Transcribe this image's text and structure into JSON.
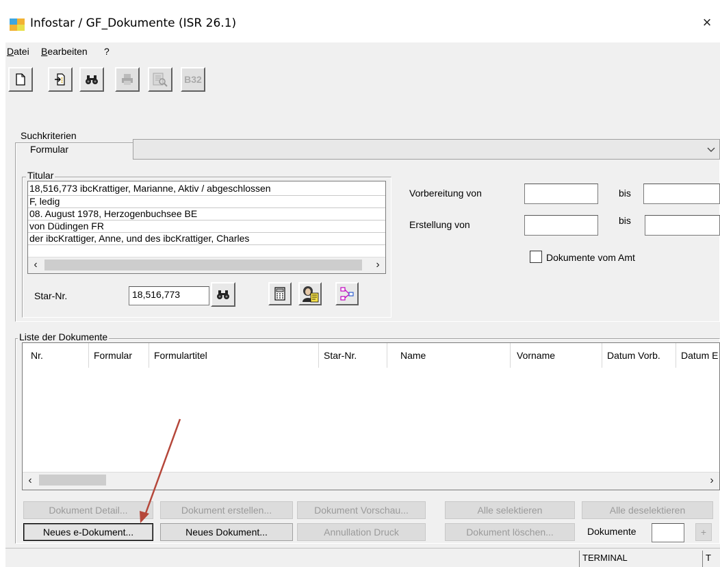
{
  "window": {
    "title": "Infostar / GF_Dokumente (ISR 26.1)",
    "close_glyph": "×"
  },
  "menu": {
    "datei_u": "D",
    "datei_rest": "atei",
    "bearbeiten_u": "B",
    "bearbeiten_rest": "earbeiten",
    "help": "?"
  },
  "toolbar": {
    "b32_label": "B32"
  },
  "search": {
    "legend": "Suchkriterien",
    "formular_label": "Formular",
    "formular_value": "",
    "titular_legend": "Titular",
    "titular_lines": [
      "18,516,773  ibcKrattiger, Marianne, Aktiv / abgeschlossen",
      "F, ledig",
      "08. August 1978, Herzogenbuchsee BE",
      "von Düdingen FR",
      "der ibcKrattiger, Anne, und des ibcKrattiger, Charles"
    ],
    "star_label": "Star-Nr.",
    "star_value": "18,516,773",
    "vorbereitung_label": "Vorbereitung von",
    "erstellung_label": "Erstellung von",
    "bis_label": "bis",
    "vom_amt_label": "Dokumente vom Amt"
  },
  "list": {
    "legend": "Liste der Dokumente",
    "columns": [
      "Nr.",
      "Formular",
      "Formulartitel",
      "Star-Nr.",
      "Name",
      "Vorname",
      "Datum Vorb.",
      "Datum E"
    ]
  },
  "buttons": {
    "detail": "Dokument Detail...",
    "erstellen": "Dokument erstellen...",
    "vorschau": "Dokument Vorschau...",
    "alle_sel": "Alle selektieren",
    "alle_desel": "Alle deselektieren",
    "neues_e": "Neues e-Dokument...",
    "neues": "Neues Dokument...",
    "annullation": "Annullation Druck",
    "loeschen": "Dokument löschen...",
    "dokumente_label": "Dokumente",
    "plus": "+"
  },
  "status": {
    "terminal": "TERMINAL",
    "t": "T"
  },
  "colors": {
    "annotation_arrow": "#b5473a"
  },
  "icons": [
    "app-icon",
    "new-document-icon",
    "import-icon",
    "binoculars-icon",
    "printer-icon",
    "print-preview-icon",
    "calculator-icon",
    "person-card-icon",
    "network-icon"
  ]
}
